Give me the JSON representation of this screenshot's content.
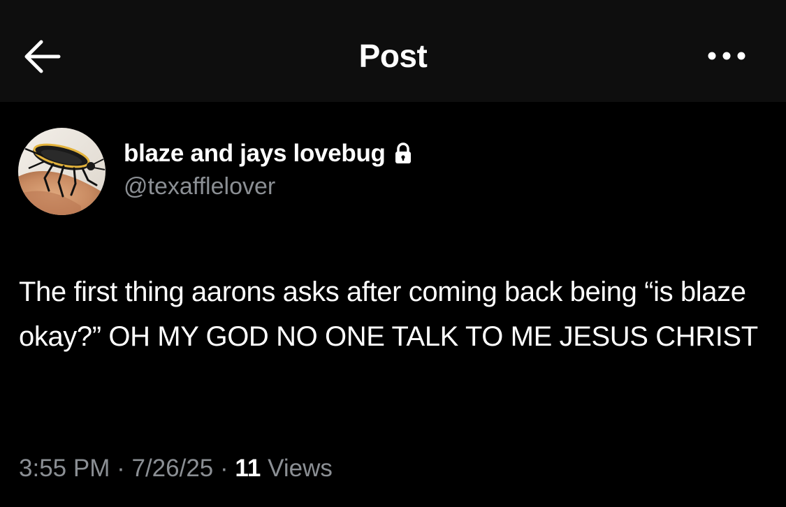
{
  "header": {
    "title": "Post",
    "back_icon": "arrow-left-icon",
    "more_icon": "more-horizontal-icon"
  },
  "author": {
    "display_name": "blaze and jays lovebug",
    "handle": "@texafflelover",
    "protected_icon": "lock-icon",
    "avatar": "beetle-on-finger-avatar"
  },
  "post": {
    "text": "The first thing aarons asks after coming back being “is blaze okay?” OH MY GOD NO ONE TALK TO ME JESUS CHRIST"
  },
  "meta": {
    "time": "3:55 PM",
    "separator": "·",
    "date": "7/26/25",
    "views_count": "11",
    "views_label": "Views"
  },
  "colors": {
    "background": "#000000",
    "header_bg": "#0e0e0e",
    "primary_text": "#ffffff",
    "secondary_text": "#8b8f94"
  }
}
